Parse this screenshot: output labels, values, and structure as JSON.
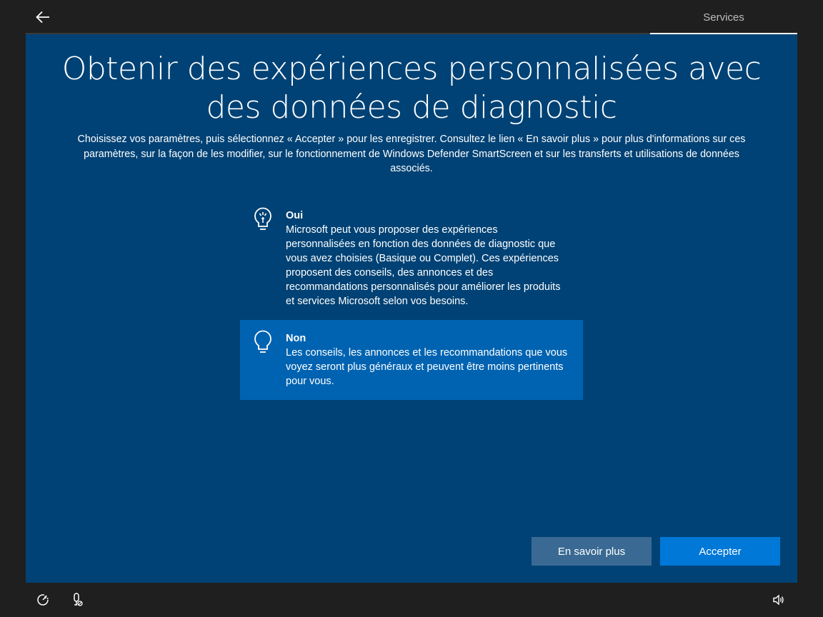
{
  "header": {
    "back_icon": "arrow-left-icon",
    "tab_label": "Services"
  },
  "main": {
    "title": "Obtenir des expériences personnalisées avec des données de diagnostic",
    "subtitle": "Choisissez vos paramètres, puis sélectionnez « Accepter » pour les enregistrer. Consultez le lien « En savoir plus » pour plus d'informations sur ces paramètres, sur la façon de les modifier, sur le fonctionnement de Windows Defender SmartScreen et sur les transferts et utilisations de données associés.",
    "options": [
      {
        "icon": "lightbulb-on-icon",
        "title": "Oui",
        "description": "Microsoft peut vous proposer des expériences personnalisées en fonction des données de diagnostic que vous avez choisies (Basique ou Complet). Ces expériences proposent des conseils, des annonces et des recommandations personnalisés pour améliorer les produits et services Microsoft selon vos besoins.",
        "selected": false
      },
      {
        "icon": "lightbulb-off-icon",
        "title": "Non",
        "description": "Les conseils, les annonces et les recommandations que vous voyez seront plus généraux et peuvent être moins pertinents pour vous.",
        "selected": true
      }
    ]
  },
  "buttons": {
    "learn_more": "En savoir plus",
    "accept": "Accepter"
  },
  "footer": {
    "icons": [
      "ease-of-access-icon",
      "microphone-icon",
      "volume-icon"
    ]
  },
  "colors": {
    "background": "#1f1f1f",
    "panel": "#004275",
    "selected_option": "#0063b1",
    "accent_button": "#0078d7",
    "secondary_button": "#3a6a93"
  }
}
